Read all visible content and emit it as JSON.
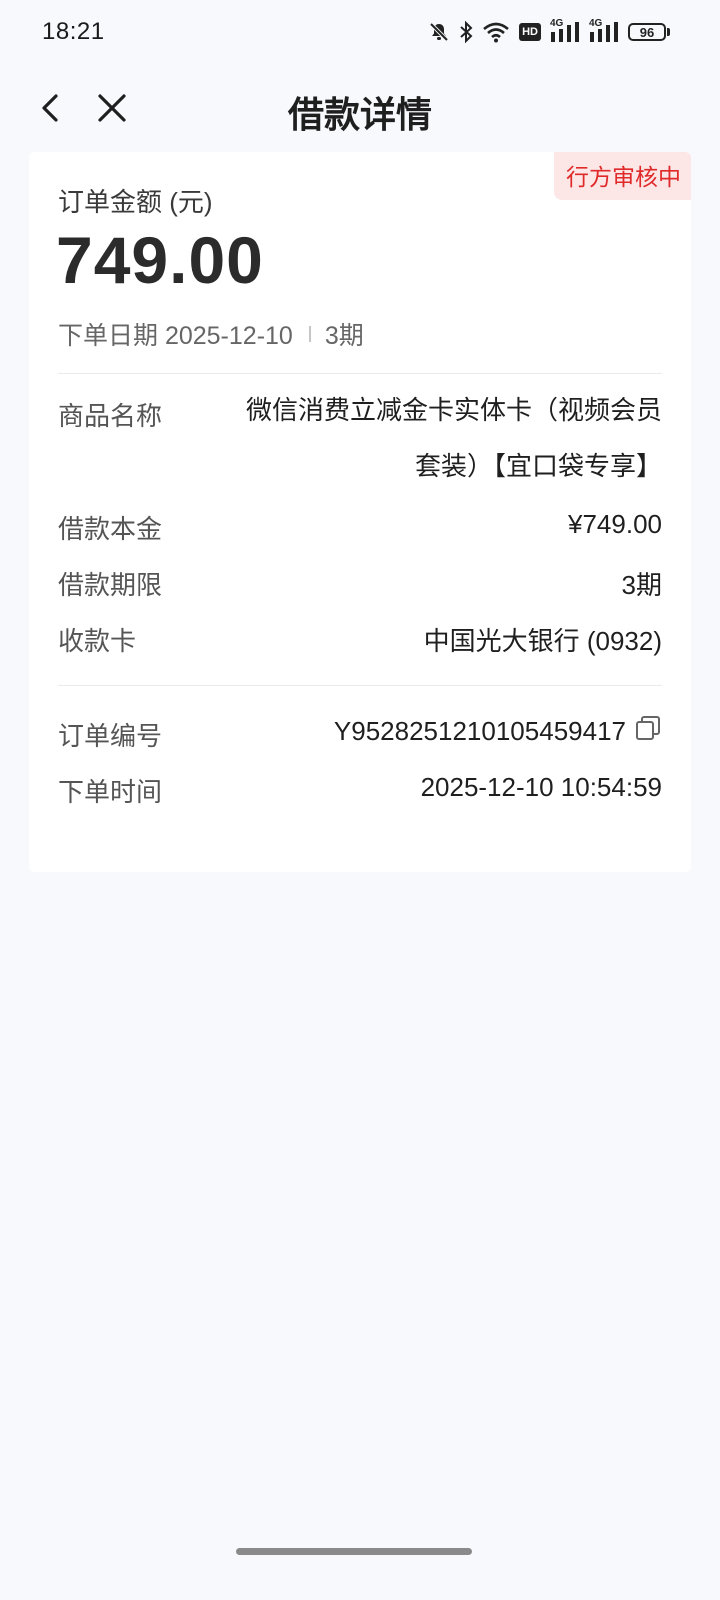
{
  "status_bar": {
    "time": "18:21",
    "icons": [
      "bell-off-icon",
      "bluetooth-icon",
      "wifi-icon",
      "hd-icon",
      "signal-4g-icon",
      "signal-4g-icon",
      "battery-icon"
    ],
    "hd_label": "HD",
    "network_label": "4G",
    "battery": "96"
  },
  "nav": {
    "title": "借款详情",
    "back_icon": "chevron-left-icon",
    "close_icon": "close-icon"
  },
  "card": {
    "status_badge": "行方审核中",
    "amount_label": "订单金额 (元)",
    "amount": "749.00",
    "order_date_label": "下单日期 2025-12-10",
    "term_short": "3期",
    "rows": [
      {
        "label": "商品名称",
        "value": "微信消费立减金卡实体卡（视频会员套装）【宜口袋专享】"
      },
      {
        "label": "借款本金",
        "value": "¥749.00"
      },
      {
        "label": "借款期限",
        "value": "3期"
      },
      {
        "label": "收款卡",
        "value": "中国光大银行 (0932)"
      },
      {
        "label": "订单编号",
        "value": "Y9528251210105459417"
      },
      {
        "label": "下单时间",
        "value": "2025-12-10 10:54:59"
      }
    ]
  },
  "colors": {
    "background": "#f8f9fd",
    "badge_bg": "#fce6e6",
    "badge_text": "#e02a2a"
  }
}
